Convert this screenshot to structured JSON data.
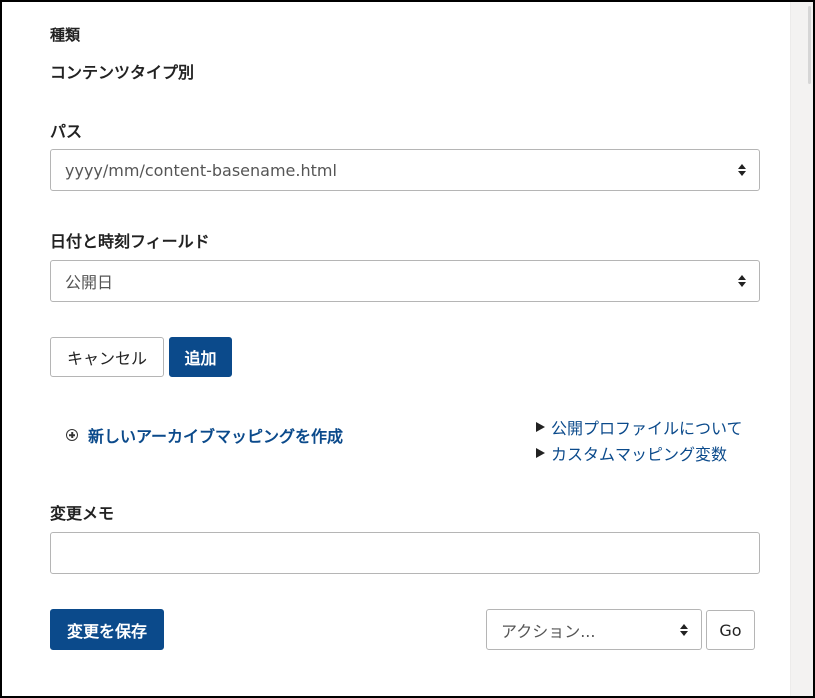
{
  "type_section": {
    "label": "種類",
    "value": "コンテンツタイプ別"
  },
  "path_section": {
    "label": "パス",
    "selected": "yyyy/mm/content-basename.html"
  },
  "datetime_section": {
    "label": "日付と時刻フィールド",
    "selected": "公開日"
  },
  "form_buttons": {
    "cancel": "キャンセル",
    "add": "追加"
  },
  "create_link": {
    "label": "新しいアーカイブマッピングを作成",
    "icon": "plus-circle-icon"
  },
  "help_links": [
    {
      "label": "公開プロファイルについて",
      "icon": "triangle-right-icon"
    },
    {
      "label": "カスタムマッピング変数",
      "icon": "triangle-right-icon"
    }
  ],
  "change_memo": {
    "label": "変更メモ",
    "value": "",
    "placeholder": ""
  },
  "footer": {
    "save": "変更を保存",
    "action_selected": "アクション...",
    "go": "Go"
  },
  "colors": {
    "primary": "#0b4a8b",
    "link": "#0b4a8b",
    "border": "#b5b5b5",
    "text": "#222222"
  }
}
